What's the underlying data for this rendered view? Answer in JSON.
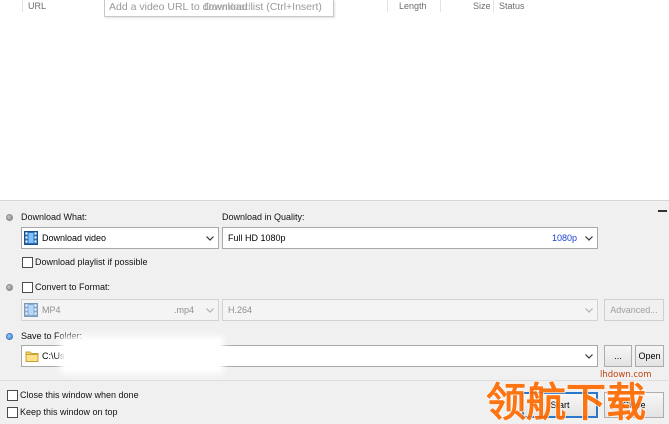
{
  "list": {
    "columns": [
      "URL",
      "Length",
      "Size",
      "Status"
    ],
    "url_placeholder": "Add a video URL to download list (Ctrl+Insert)",
    "overlap_text": "Download"
  },
  "download_what": {
    "label": "Download What:",
    "selected": "Download video",
    "playlist_checkbox_label": "Download playlist if possible",
    "playlist_checked": false
  },
  "quality": {
    "label": "Download in Quality:",
    "selected": "Full HD 1080p",
    "badge": "1080p",
    "badge_color": "#1a3fd6"
  },
  "convert": {
    "label": "Convert to Format:",
    "checked": false,
    "format": "MP4",
    "extension": ".mp4",
    "codec": "H.264",
    "advanced_button": "Advanced..."
  },
  "save": {
    "label": "Save to Folder:",
    "path": "C:\\Us",
    "browse_button": "...",
    "open_button": "Open"
  },
  "bottom": {
    "close_when_done_label": "Close this window when done",
    "close_when_done_checked": false,
    "keep_on_top_label": "Keep this window on top",
    "keep_on_top_checked": false,
    "start_button": "Start",
    "close_button": "Close"
  },
  "watermark": {
    "text": "领航下载",
    "url": "lhdown.com",
    "color": "#ff6a00"
  }
}
